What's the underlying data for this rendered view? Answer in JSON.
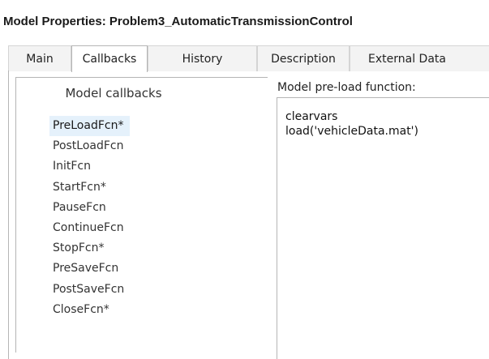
{
  "window": {
    "title": "Model Properties: Problem3_AutomaticTransmissionControl"
  },
  "tabs": [
    {
      "label": "Main",
      "active": false
    },
    {
      "label": "Callbacks",
      "active": true
    },
    {
      "label": "History",
      "active": false
    },
    {
      "label": "Description",
      "active": false
    },
    {
      "label": "External Data",
      "active": false
    }
  ],
  "callbacks": {
    "header": "Model callbacks",
    "items": [
      {
        "label": "PreLoadFcn*",
        "selected": true
      },
      {
        "label": "PostLoadFcn",
        "selected": false
      },
      {
        "label": "InitFcn",
        "selected": false
      },
      {
        "label": "StartFcn*",
        "selected": false
      },
      {
        "label": "PauseFcn",
        "selected": false
      },
      {
        "label": "ContinueFcn",
        "selected": false
      },
      {
        "label": "StopFcn*",
        "selected": false
      },
      {
        "label": "PreSaveFcn",
        "selected": false
      },
      {
        "label": "PostSaveFcn",
        "selected": false
      },
      {
        "label": "CloseFcn*",
        "selected": false
      }
    ]
  },
  "editor": {
    "label": "Model pre-load function:",
    "code": "clearvars\nload('vehicleData.mat')"
  },
  "colors": {
    "selection": "#e5f1fb",
    "border": "#b5b5b5",
    "tab_inactive": "#f3f3f3"
  }
}
